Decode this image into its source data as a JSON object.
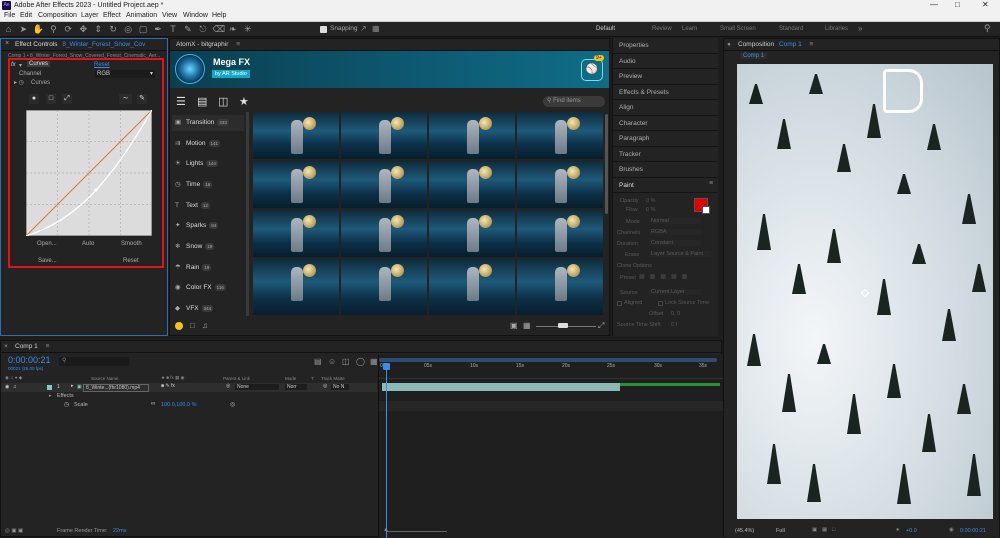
{
  "window": {
    "title": "Adobe After Effects 2023 - Untitled Project.aep *",
    "app_badge": "Ae"
  },
  "menu": [
    "File",
    "Edit",
    "Composition",
    "Layer",
    "Effect",
    "Animation",
    "View",
    "Window",
    "Help"
  ],
  "toolbar": {
    "snapping_label": "Snapping",
    "workspaces": [
      "Default",
      "Review",
      "Learn",
      "Small Screen",
      "Standard",
      "Libraries"
    ]
  },
  "effect_controls": {
    "tab_label": "Effect Controls",
    "tab_file": "8_Winter_Forest_Snow_Cov",
    "source_line": "Comp 1 • 8_Winter_Forest_Snow_Covered_Forest_Cinematic_Aer...",
    "fx_label": "fx",
    "effect_name": "Curves",
    "reset_link": "Reset",
    "channel_label": "Channel",
    "channel_value": "RGB",
    "curves_label": "Curves",
    "buttons": {
      "open": "Open...",
      "auto": "Auto",
      "smooth": "Smooth",
      "save": "Save...",
      "reset": "Reset"
    }
  },
  "atomx": {
    "tab_label": "AtomX - bitgraphir",
    "brand": "Mega FX",
    "byline": "by AR Studio",
    "cart_badge": "9+",
    "search_placeholder": "Find items",
    "categories": [
      {
        "name": "Transition",
        "count": "333"
      },
      {
        "name": "Motion",
        "count": "141"
      },
      {
        "name": "Lights",
        "count": "144"
      },
      {
        "name": "Time",
        "count": "16"
      },
      {
        "name": "Text",
        "count": "12"
      },
      {
        "name": "Sparks",
        "count": "84"
      },
      {
        "name": "Snow",
        "count": "19"
      },
      {
        "name": "Rain",
        "count": "19"
      },
      {
        "name": "Color FX",
        "count": "116"
      },
      {
        "name": "VFX",
        "count": "344"
      }
    ]
  },
  "right_panels": [
    "Properties",
    "Audio",
    "Preview",
    "Effects & Presets",
    "Align",
    "Character",
    "Paragraph",
    "Tracker",
    "Brushes",
    "Paint"
  ],
  "paint": {
    "opacity_label": "Opacity",
    "opacity_value": "0 %",
    "flow_label": "Flow",
    "flow_value": "0 %",
    "mode_label": "Mode",
    "mode_value": "Normal",
    "channels_label": "Channels",
    "channels_value": "RGBA",
    "duration_label": "Duration",
    "duration_value": "Constant",
    "erase_label": "Erase",
    "erase_value": "Layer Source & Paint",
    "clone_options_label": "Clone Options",
    "preset_label": "Preset",
    "source_label": "Source",
    "source_value": "Current Layer",
    "aligned_label": "Aligned",
    "lock_label": "Lock Source Time",
    "offset_label": "Offset",
    "offset_value": "0, 0",
    "source_time_label": "Source Time Shift",
    "source_time_value": "0 f",
    "fg_color": "#e00000",
    "bg_color": "#ffffff"
  },
  "composition": {
    "tab_label": "Composition",
    "comp_name": "Comp 1",
    "breadcrumb": "Comp 1",
    "zoom": "(45.4%)",
    "resolution": "Full",
    "timecode": "0:00:00:21",
    "exposure": "+0.0",
    "logo_color": "#ffffff"
  },
  "timeline": {
    "tab_label": "Comp 1",
    "timecode": "0:00:00:21",
    "fps_note": "00021 (25.00 fps)",
    "search_placeholder": "",
    "headers": {
      "source": "Source Name",
      "parent": "Parent & Link",
      "mode": "Mode",
      "t": "T",
      "track": "Track Matte"
    },
    "layer": {
      "index": "1",
      "name": "8_Winte...(fhr1080).mp4",
      "mode": "Norr",
      "track": "No N",
      "parent": "None"
    },
    "effects_label": "Effects",
    "scale_label": "Scale",
    "scale_value": "100.0,100.0 %",
    "ruler": [
      "0s",
      "05s",
      "10s",
      "15s",
      "20s",
      "25s",
      "30s",
      "35s"
    ],
    "render_time_label": "Frame Render Time:",
    "render_time_value": "22ms"
  }
}
